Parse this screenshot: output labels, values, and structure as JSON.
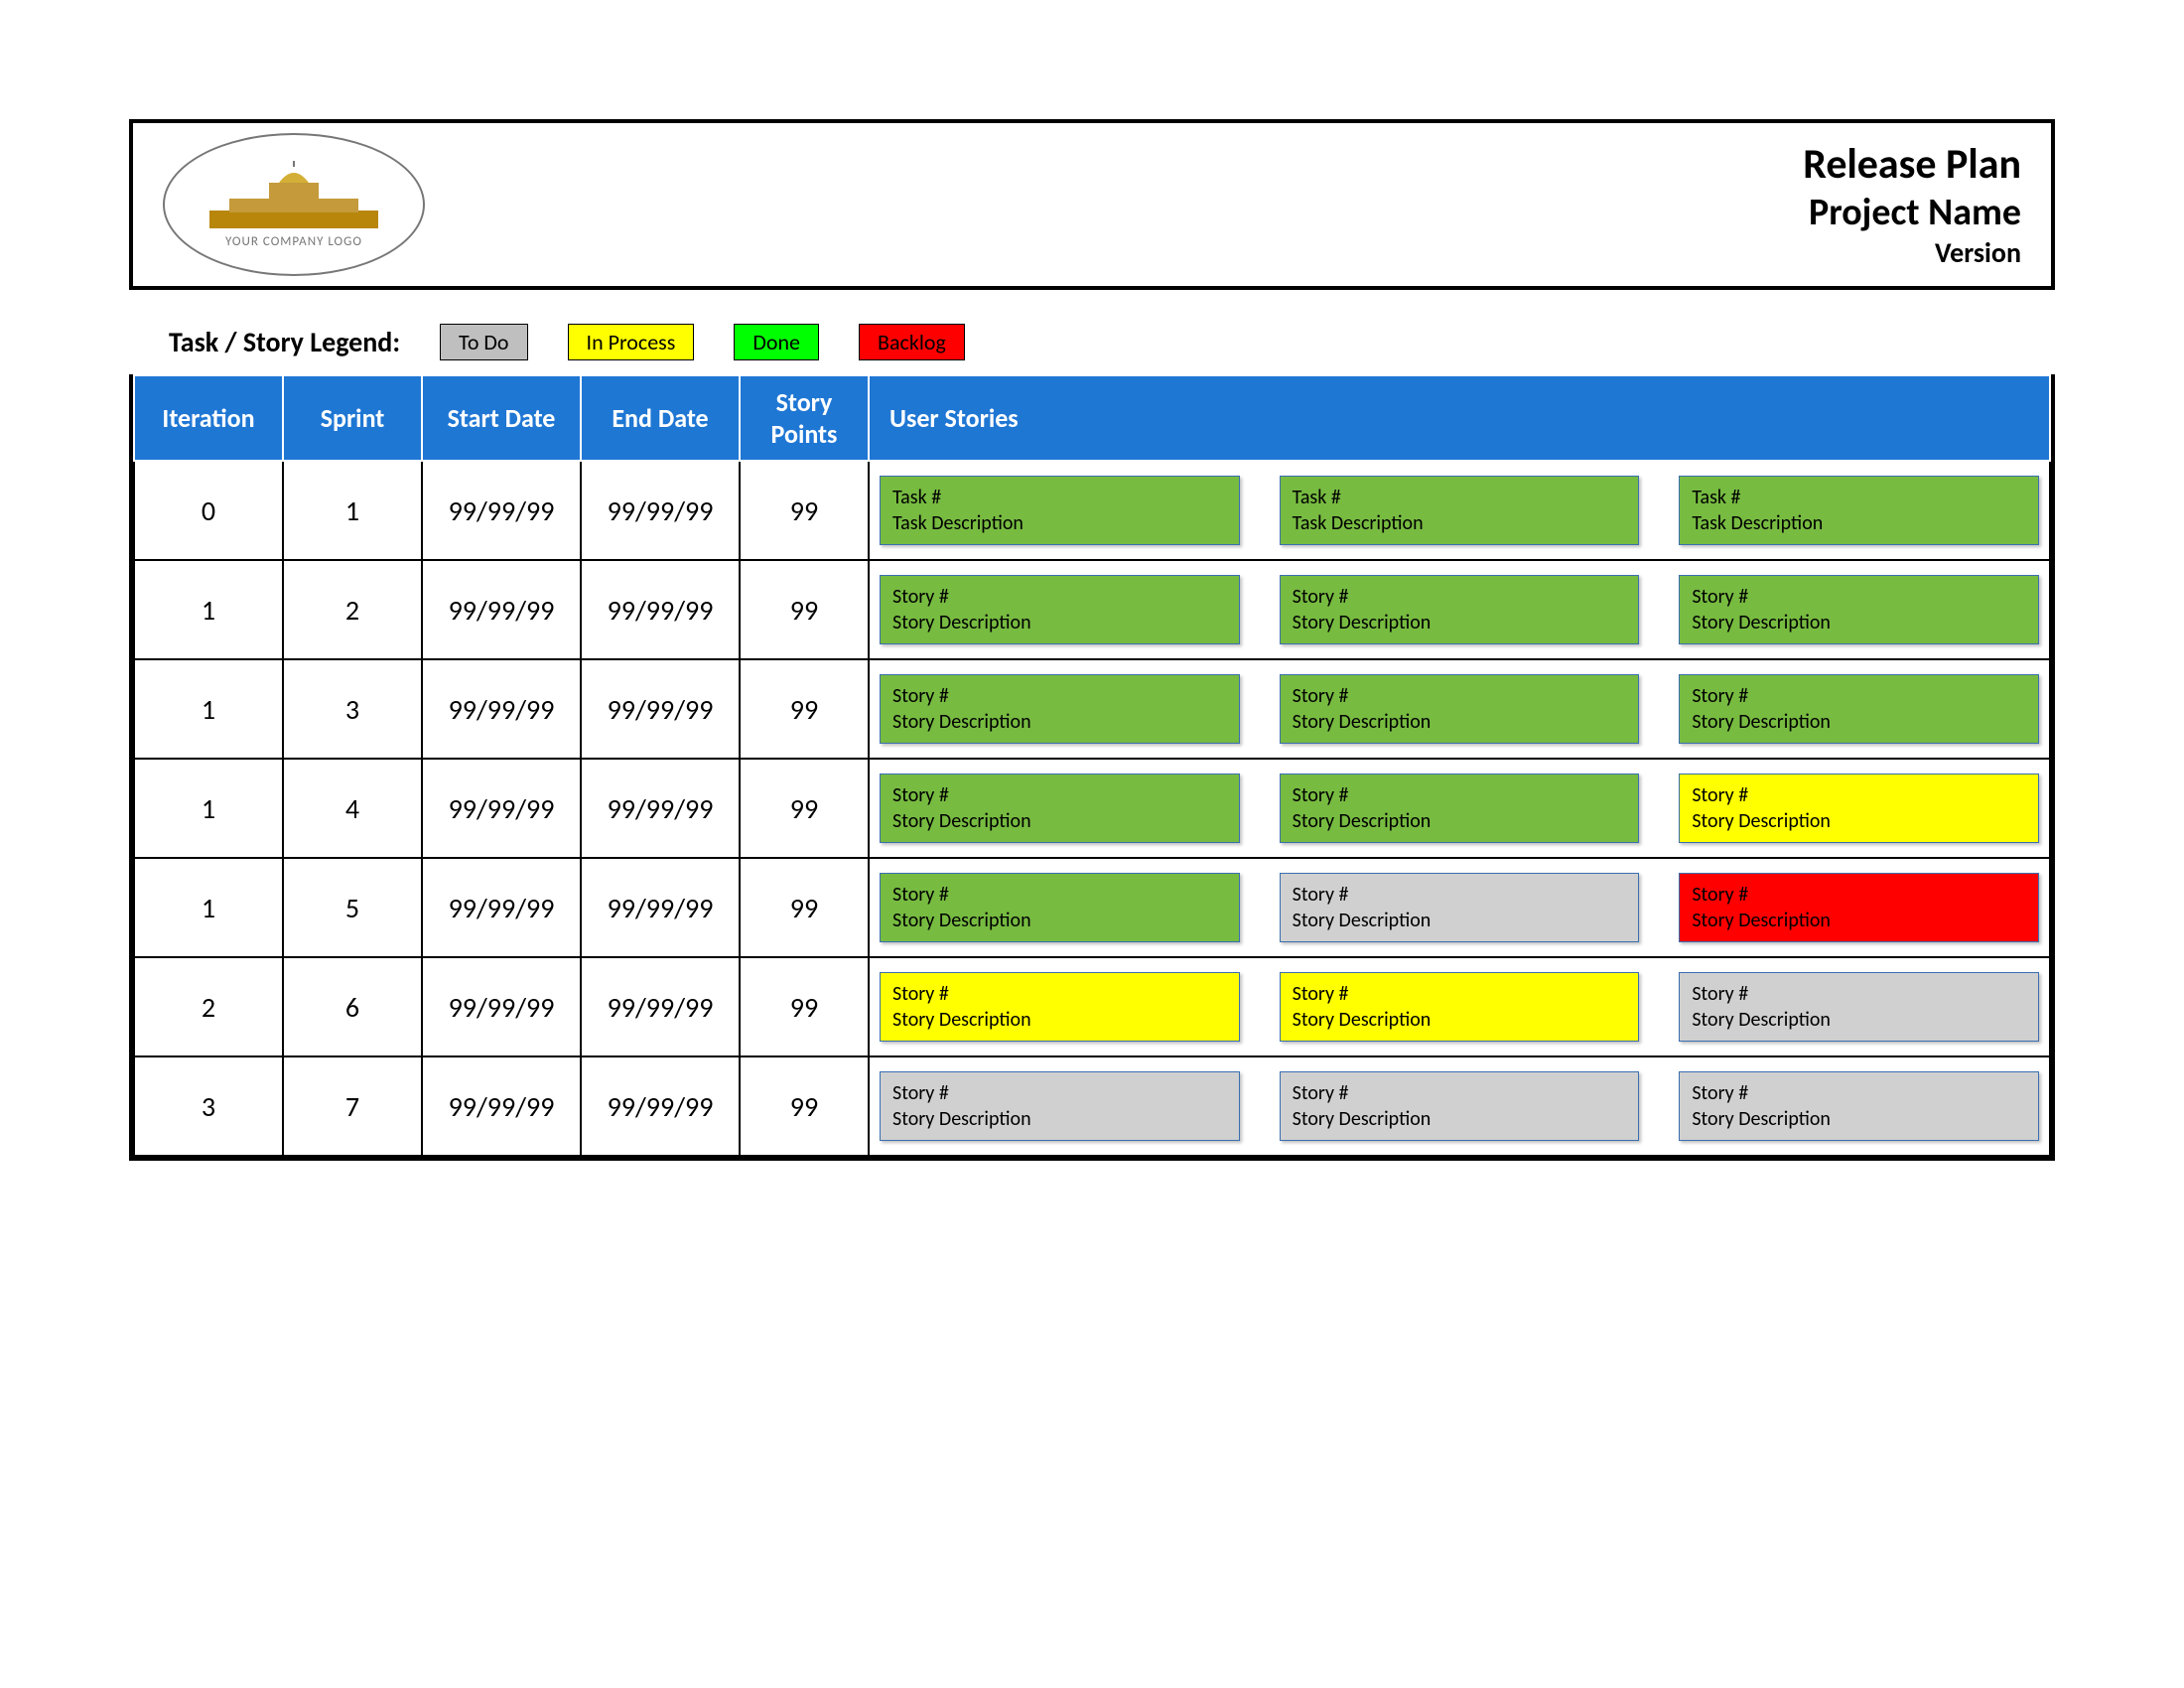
{
  "header": {
    "title1": "Release Plan",
    "title2": "Project Name",
    "title3": "Version",
    "logo_caption": "YOUR COMPANY LOGO"
  },
  "legend": {
    "label": "Task / Story Legend:",
    "todo": "To Do",
    "inprocess": "In Process",
    "done": "Done",
    "backlog": "Backlog"
  },
  "columns": {
    "c1": "Iteration",
    "c2": "Sprint",
    "c3": "Start Date",
    "c4": "End Date",
    "c5": "Story Points",
    "c6": "User Stories"
  },
  "status_colors": {
    "green": "c-green",
    "yellow": "c-yellow",
    "red": "c-red",
    "grey": "c-grey"
  },
  "rows": [
    {
      "iteration": "0",
      "sprint": "1",
      "start": "99/99/99",
      "end": "99/99/99",
      "points": "99",
      "cards": [
        {
          "line1": "Task #",
          "line2": "Task Description",
          "status": "green"
        },
        {
          "line1": "Task #",
          "line2": "Task Description",
          "status": "green"
        },
        {
          "line1": "Task #",
          "line2": "Task Description",
          "status": "green"
        }
      ]
    },
    {
      "iteration": "1",
      "sprint": "2",
      "start": "99/99/99",
      "end": "99/99/99",
      "points": "99",
      "cards": [
        {
          "line1": "Story #",
          "line2": "Story Description",
          "status": "green"
        },
        {
          "line1": "Story #",
          "line2": "Story Description",
          "status": "green"
        },
        {
          "line1": "Story #",
          "line2": "Story Description",
          "status": "green"
        }
      ]
    },
    {
      "iteration": "1",
      "sprint": "3",
      "start": "99/99/99",
      "end": "99/99/99",
      "points": "99",
      "cards": [
        {
          "line1": "Story #",
          "line2": "Story Description",
          "status": "green"
        },
        {
          "line1": "Story #",
          "line2": "Story Description",
          "status": "green"
        },
        {
          "line1": "Story #",
          "line2": "Story Description",
          "status": "green"
        }
      ]
    },
    {
      "iteration": "1",
      "sprint": "4",
      "start": "99/99/99",
      "end": "99/99/99",
      "points": "99",
      "cards": [
        {
          "line1": "Story #",
          "line2": "Story Description",
          "status": "green"
        },
        {
          "line1": "Story #",
          "line2": "Story Description",
          "status": "green"
        },
        {
          "line1": "Story #",
          "line2": "Story Description",
          "status": "yellow"
        }
      ]
    },
    {
      "iteration": "1",
      "sprint": "5",
      "start": "99/99/99",
      "end": "99/99/99",
      "points": "99",
      "cards": [
        {
          "line1": "Story #",
          "line2": "Story Description",
          "status": "green"
        },
        {
          "line1": "Story #",
          "line2": "Story Description",
          "status": "grey"
        },
        {
          "line1": "Story #",
          "line2": "Story Description",
          "status": "red"
        }
      ]
    },
    {
      "iteration": "2",
      "sprint": "6",
      "start": "99/99/99",
      "end": "99/99/99",
      "points": "99",
      "cards": [
        {
          "line1": "Story #",
          "line2": "Story Description",
          "status": "yellow"
        },
        {
          "line1": "Story #",
          "line2": "Story Description",
          "status": "yellow"
        },
        {
          "line1": "Story #",
          "line2": "Story Description",
          "status": "grey"
        }
      ]
    },
    {
      "iteration": "3",
      "sprint": "7",
      "start": "99/99/99",
      "end": "99/99/99",
      "points": "99",
      "cards": [
        {
          "line1": "Story #",
          "line2": "Story Description",
          "status": "grey"
        },
        {
          "line1": "Story #",
          "line2": "Story Description",
          "status": "grey"
        },
        {
          "line1": "Story #",
          "line2": "Story Description",
          "status": "grey"
        }
      ]
    }
  ]
}
